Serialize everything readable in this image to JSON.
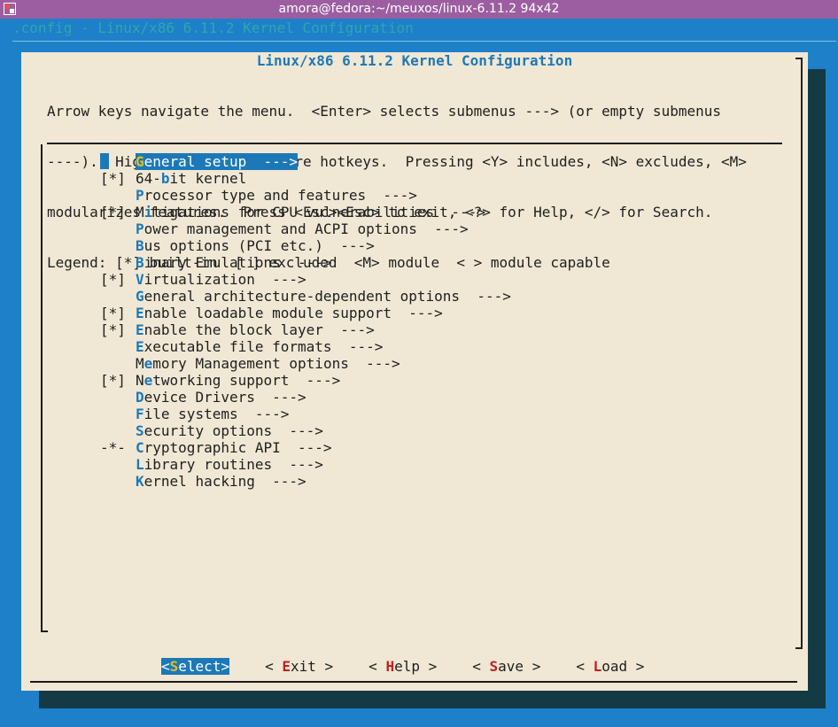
{
  "window": {
    "title": "amora@fedora:~/meuxos/linux-6.11.2 94x42"
  },
  "background_title": ".config - Linux/x86 6.11.2 Kernel Configuration",
  "dialog": {
    "title": "Linux/x86 6.11.2 Kernel Configuration",
    "help_lines": [
      "Arrow keys navigate the menu.  <Enter> selects submenus ---> (or empty submenus",
      "----).  Highlighted letters are hotkeys.  Pressing <Y> includes, <N> excludes, <M>",
      "modularizes features.  Press <Esc><Esc> to exit, <?> for Help, </> for Search.",
      "Legend: [*] built-in  [ ] excluded  <M> module  < > module capable"
    ]
  },
  "menu": [
    {
      "mark": "",
      "hotkey": "G",
      "rest": "eneral setup  --->",
      "selected": true
    },
    {
      "mark": "[*]",
      "pre": "64-",
      "hotkey": "b",
      "rest": "it kernel"
    },
    {
      "mark": "",
      "hotkey": "P",
      "rest": "rocessor type and features  --->"
    },
    {
      "mark": "[*]",
      "pre": "M",
      "hotkey": "i",
      "rest": "tigations for CPU vulnerabilities  --->"
    },
    {
      "mark": "",
      "hotkey": "P",
      "rest": "ower management and ACPI options  --->"
    },
    {
      "mark": "",
      "hotkey": "B",
      "rest": "us options (PCI etc.)  --->"
    },
    {
      "mark": "",
      "hotkey": "B",
      "rest": "inary Emulations  --->"
    },
    {
      "mark": "[*]",
      "hotkey": "V",
      "rest": "irtualization  --->"
    },
    {
      "mark": "",
      "hotkey": "G",
      "rest": "eneral architecture-dependent options  --->"
    },
    {
      "mark": "[*]",
      "hotkey": "E",
      "rest": "nable loadable module support  --->"
    },
    {
      "mark": "[*]",
      "hotkey": "E",
      "rest": "nable the block layer  --->"
    },
    {
      "mark": "",
      "hotkey": "E",
      "rest": "xecutable file formats  --->"
    },
    {
      "mark": "",
      "pre": "M",
      "hotkey": "e",
      "rest": "mory Management options  --->"
    },
    {
      "mark": "[*]",
      "pre": "N",
      "hotkey": "e",
      "rest": "tworking support  --->"
    },
    {
      "mark": "",
      "hotkey": "D",
      "rest": "evice Drivers  --->"
    },
    {
      "mark": "",
      "hotkey": "F",
      "rest": "ile systems  --->"
    },
    {
      "mark": "",
      "hotkey": "S",
      "rest": "ecurity options  --->"
    },
    {
      "mark": "-*-",
      "hotkey": "C",
      "rest": "ryptographic API  --->"
    },
    {
      "mark": "",
      "hotkey": "L",
      "rest": "ibrary routines  --->"
    },
    {
      "mark": "",
      "hotkey": "K",
      "rest": "ernel hacking  --->"
    }
  ],
  "buttons": [
    {
      "left": "<",
      "hotkey": "S",
      "rest": "elect",
      "right": ">",
      "active": true,
      "name": "select-button"
    },
    {
      "left": "< ",
      "hotkey": "E",
      "rest": "xit",
      "right": " >",
      "name": "exit-button"
    },
    {
      "left": "< ",
      "hotkey": "H",
      "rest": "elp",
      "right": " >",
      "name": "help-button"
    },
    {
      "left": "< ",
      "hotkey": "S",
      "rest": "ave",
      "right": " >",
      "name": "save-button"
    },
    {
      "left": "< ",
      "hotkey": "L",
      "rest": "oad",
      "right": " >",
      "name": "load-button"
    }
  ]
}
